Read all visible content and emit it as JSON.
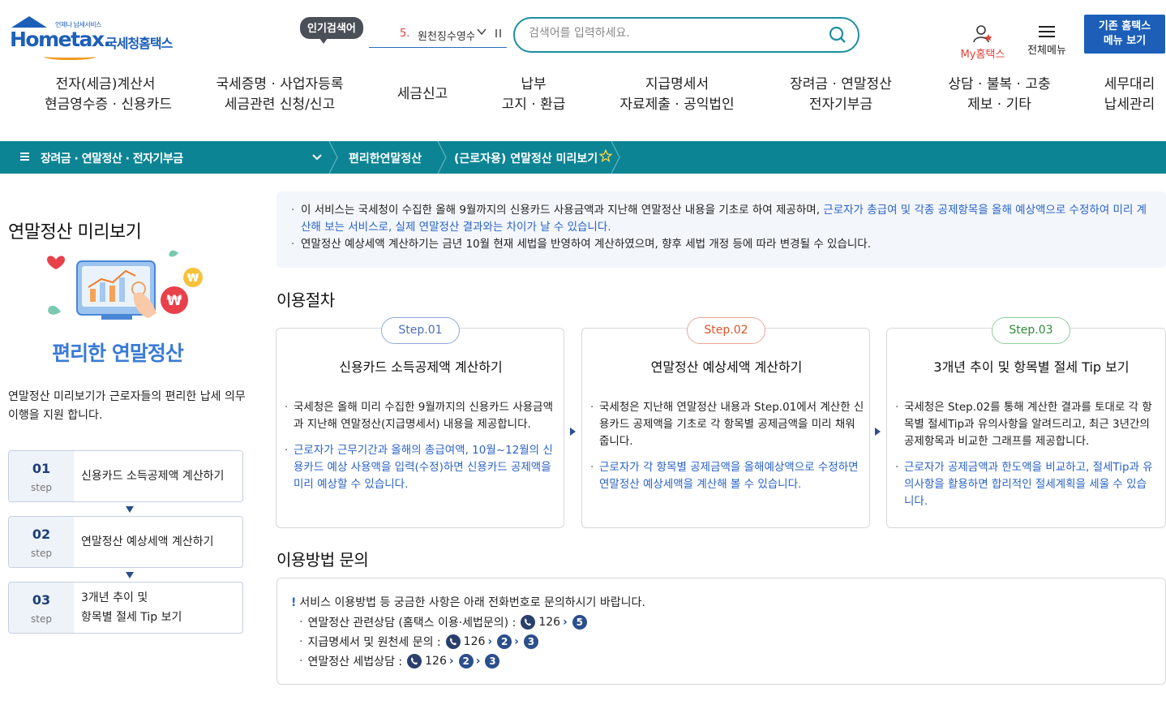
{
  "header": {
    "logo_small": "언제나 납세서비스",
    "logo_brand": "Hometax.",
    "logo_kr": "국세청홈택스",
    "popular_badge": "인기검색어",
    "popular_rank": "5.",
    "popular_term": "원천징수영수증",
    "search_placeholder": "검색어를 입력하세요.",
    "my_label": "My홈택스",
    "all_menu_label": "전체메뉴",
    "old_menu_line1": "기존 홈택스",
    "old_menu_line2": "메뉴 보기"
  },
  "gnb": [
    {
      "line1": "전자(세금)계산서",
      "line2": "현금영수증 · 신용카드"
    },
    {
      "line1": "국세증명 · 사업자등록",
      "line2": "세금관련 신청/신고"
    },
    {
      "line1": "세금신고",
      "line2": ""
    },
    {
      "line1": "납부",
      "line2": "고지 · 환급"
    },
    {
      "line1": "지급명세서",
      "line2": "자료제출 · 공익법인"
    },
    {
      "line1": "장려금 · 연말정산",
      "line2": "전자기부금"
    },
    {
      "line1": "상담 · 불복 · 고충",
      "line2": "제보 · 기타"
    },
    {
      "line1": "세무대리",
      "line2": "납세관리"
    }
  ],
  "breadcrumb": {
    "category": "장려금 · 연말정산 · 전자기부금",
    "item1": "편리한연말정산",
    "item2": "(근로자용) 연말정산 미리보기"
  },
  "left": {
    "title": "연말정산 미리보기",
    "subtitle": "편리한 연말정산",
    "desc": "연말정산 미리보기가 근로자들의  편리한 납세 의무 이행을 지원 합니다.",
    "steps": [
      {
        "num": "01",
        "word": "step",
        "label1": "신용카드 소득공제액 계산하기",
        "label2": ""
      },
      {
        "num": "02",
        "word": "step",
        "label1": "연말정산 예상세액 계산하기",
        "label2": ""
      },
      {
        "num": "03",
        "word": "step",
        "label1": "3개년 추이 및",
        "label2": "항목별 절세 Tip 보기"
      }
    ]
  },
  "notice": {
    "line1_black": "이 서비스는 국세청이 수집한 올해 9월까지의 신용카드 사용금액과 지난해 연말정산 내용을 기초로 하여 제공하며, ",
    "line1_blue": "근로자가 총급여 및 각종 공제항목을 올해 예상액으로 수정하여 미리 계산해 보는 서비스로, 실제 연말정산 결과와는 차이가 날 수 있습니다.",
    "line2": "연말정산 예상세액 계산하기는 금년 10월 현재 세법을 반영하여 계산하였으며, 향후 세법 개정 등에 따라 변경될 수 있습니다."
  },
  "section_procedure": "이용절차",
  "cards": [
    {
      "step": "Step.01",
      "color": "#4a6fb5",
      "title": "신용카드 소득공제액 계산하기",
      "black": "국세청은 올해 미리 수집한 9월까지의 신용카드 사용금액과 지난해 연말정산(지급명세서) 내용을 제공합니다.",
      "blue": "근로자가 근무기간과 올해의 총급여액, 10월~12월의 신용카드 예상 사용액을 입력(수정)하면 신용카드 공제액을 미리 예상할 수 있습니다."
    },
    {
      "step": "Step.02",
      "color": "#d9532c",
      "title": "연말정산 예상세액 계산하기",
      "black": "국세청은 지난해 연말정산 내용과 Step.01에서 계산한 신용카드 공제액을 기초로 각 항목별 공제금액을 미리 채워줍니다.",
      "blue": "근로자가 각 항목별 공제금액을 올해예상액으로 수정하면 연말정산 예상세액을 계산해 볼 수 있습니다."
    },
    {
      "step": "Step.03",
      "color": "#2e8b3a",
      "title": "3개년 추이 및 항목별 절세 Tip 보기",
      "black": "국세청은 Step.02를 통해 계산한 결과를 토대로 각 항목별 절세Tip과 유의사항을 알려드리고, 최근 3년간의 공제항목과 비교한 그래프를 제공합니다.",
      "blue": "근로자가 공제금액과 한도액을 비교하고, 절세Tip과 유의사항을 활용하면 합리적인 절세계획을 세울 수 있습니다."
    }
  ],
  "section_inquiry": "이용방법 문의",
  "inquiry": {
    "head": "서비스 이용방법 등 궁금한 사항은 아래 전화번호로 문의하시기 바랍니다.",
    "rows": [
      {
        "label": "연말정산 관련상담 (홈택스 이용·세법문의) :",
        "phone": "126",
        "n1": "5",
        "n2": ""
      },
      {
        "label": "지급명세서 및 원천세 문의 :",
        "phone": "126",
        "n1": "2",
        "n2": "3"
      },
      {
        "label": "연말정산 세법상담 :",
        "phone": "126",
        "n1": "2",
        "n2": "3"
      }
    ]
  }
}
